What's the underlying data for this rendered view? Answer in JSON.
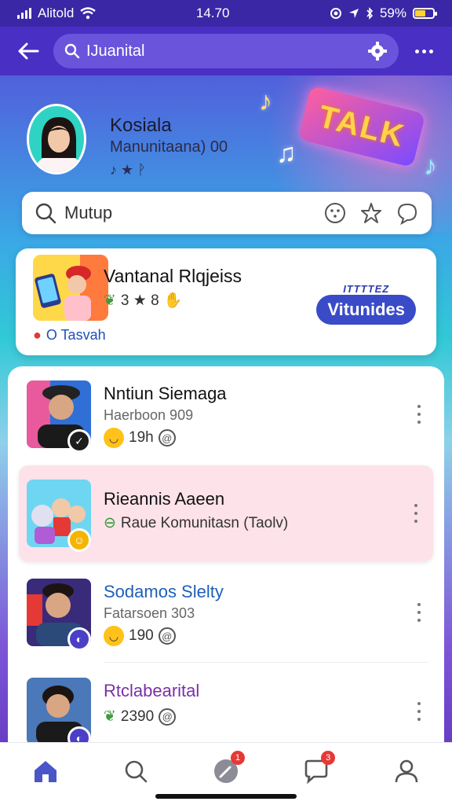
{
  "status_bar": {
    "carrier": "Alitold",
    "time": "14.70",
    "battery": "59%"
  },
  "appbar": {
    "search_text": "IJuanital"
  },
  "profile": {
    "name": "Kosiala",
    "subtitle": "Manunitaana) 00",
    "badges": "♪ ★ ᚹ"
  },
  "banner": {
    "sign": "TALK"
  },
  "search2": {
    "placeholder": "Mutup"
  },
  "featured": {
    "title": "Vantanal Rlqjeiss",
    "meta": "3 ★ 8",
    "tag": "O Tasvah",
    "button_top": "ITTTTEZ",
    "button": "Vitunides"
  },
  "list": [
    {
      "title": "Nntiun Siemaga",
      "subtitle": "Haerboon 909",
      "meta": "19h",
      "title_color": "#111111",
      "badge_color": "#1d1d1d"
    },
    {
      "title": "Rieannis Aaeen",
      "subtitle": "",
      "meta": "Raue Komunitasn (Taolv)",
      "title_color": "#111111",
      "badge_color": "#f5b400"
    },
    {
      "title": "Sodamos Slelty",
      "subtitle": "Fatarsoen 303",
      "meta": "190",
      "title_color": "#1e5fb8",
      "badge_color": "#4b3fc7"
    },
    {
      "title": "Rtclabearital",
      "subtitle": "",
      "meta": "2390",
      "title_color": "#7a2fa8",
      "badge_color": "#4b3fc7"
    }
  ],
  "nav": {
    "items": [
      "home-icon",
      "search-icon",
      "create-icon",
      "chat-icon",
      "profile-icon"
    ],
    "badges": [
      "1",
      "3"
    ]
  },
  "colors": {
    "accent": "#4a2fc4",
    "highlight": "#fde2ea"
  }
}
